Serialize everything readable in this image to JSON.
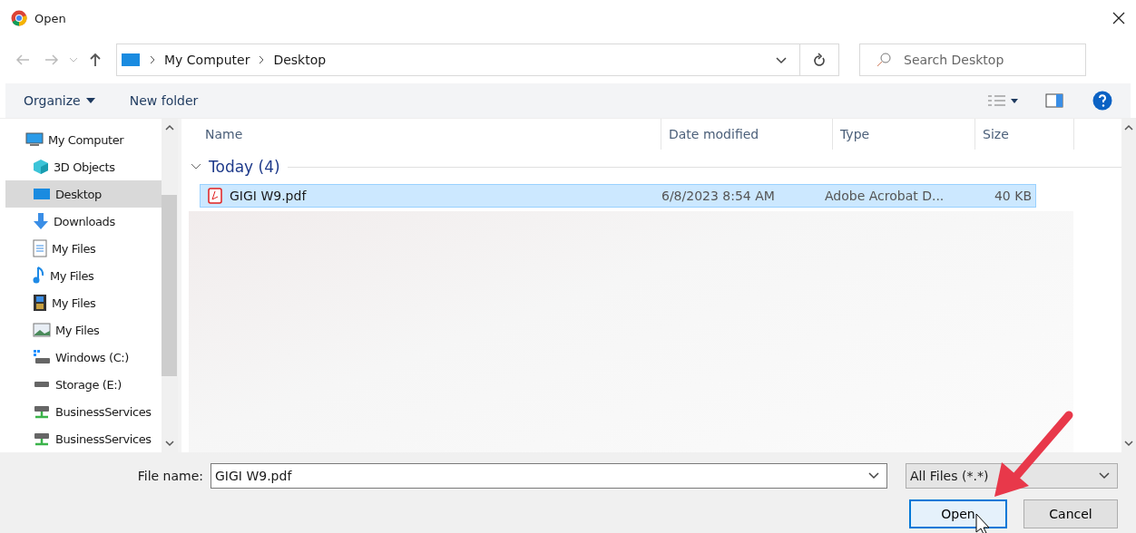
{
  "window": {
    "title": "Open"
  },
  "address": {
    "path": [
      "My Computer",
      "Desktop"
    ]
  },
  "search": {
    "placeholder": "Search Desktop"
  },
  "toolbar": {
    "organize": "Organize",
    "new_folder": "New folder"
  },
  "sidebar": {
    "items": [
      {
        "label": "My Computer",
        "kind": "computer",
        "selected": false,
        "indent": false
      },
      {
        "label": "3D Objects",
        "kind": "cube",
        "selected": false,
        "indent": true
      },
      {
        "label": "Desktop",
        "kind": "desktop",
        "selected": true,
        "indent": true
      },
      {
        "label": "Downloads",
        "kind": "download",
        "selected": false,
        "indent": true
      },
      {
        "label": "My Files",
        "kind": "document",
        "selected": false,
        "indent": true
      },
      {
        "label": "My Files",
        "kind": "music",
        "selected": false,
        "indent": true
      },
      {
        "label": "My Files",
        "kind": "video",
        "selected": false,
        "indent": true
      },
      {
        "label": "My Files",
        "kind": "image",
        "selected": false,
        "indent": true
      },
      {
        "label": "Windows (C:)",
        "kind": "windows-drive",
        "selected": false,
        "indent": true
      },
      {
        "label": "Storage (E:)",
        "kind": "drive",
        "selected": false,
        "indent": true
      },
      {
        "label": "BusinessServices",
        "kind": "network-drive",
        "selected": false,
        "indent": true
      },
      {
        "label": "BusinessServices",
        "kind": "network-drive",
        "selected": false,
        "indent": true
      }
    ]
  },
  "table": {
    "columns": [
      "Name",
      "Date modified",
      "Type",
      "Size"
    ],
    "group": {
      "label": "Today (4)",
      "expanded": true
    },
    "rows": [
      {
        "name": "GIGI W9.pdf",
        "date": "6/8/2023 8:54 AM",
        "type": "Adobe Acrobat D...",
        "size": "40 KB",
        "selected": true
      }
    ]
  },
  "file_name": {
    "label": "File name:",
    "value": "GIGI W9.pdf"
  },
  "file_type": {
    "value": "All Files (*.*)"
  },
  "buttons": [
    {
      "label": "Open",
      "kind": "primary"
    },
    {
      "label": "Cancel",
      "kind": "secondary"
    }
  ]
}
